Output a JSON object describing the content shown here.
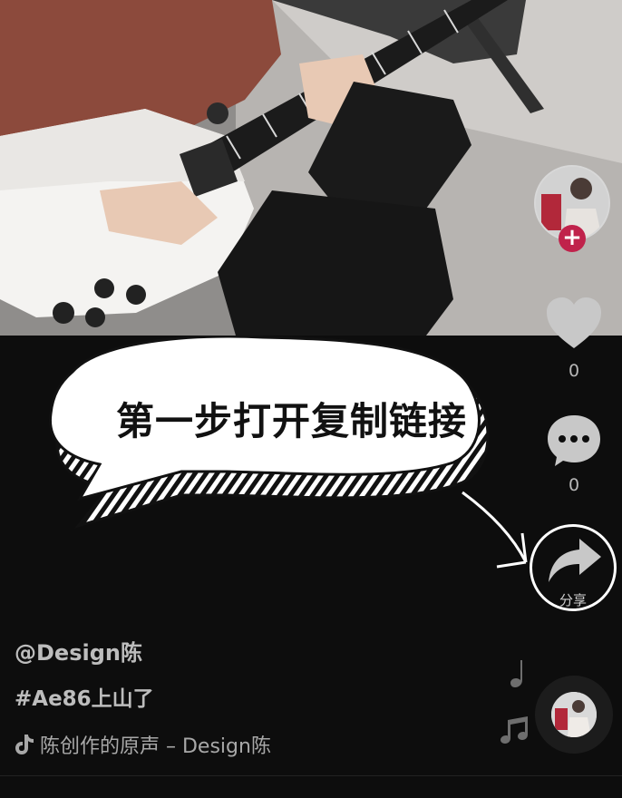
{
  "overlay": {
    "callout_text": "第一步打开复制链接"
  },
  "rail": {
    "like_count": "0",
    "comment_count": "0",
    "share_label": "分享",
    "follow_symbol": "+"
  },
  "video_info": {
    "username": "@Design陈",
    "hashtag": "#Ae86上山了",
    "music_text": "陈创作的原声 – Design陈"
  },
  "colors": {
    "background": "#0d0d0d",
    "follow_accent": "#c0224b",
    "icon_gray": "#c8c8c8"
  }
}
